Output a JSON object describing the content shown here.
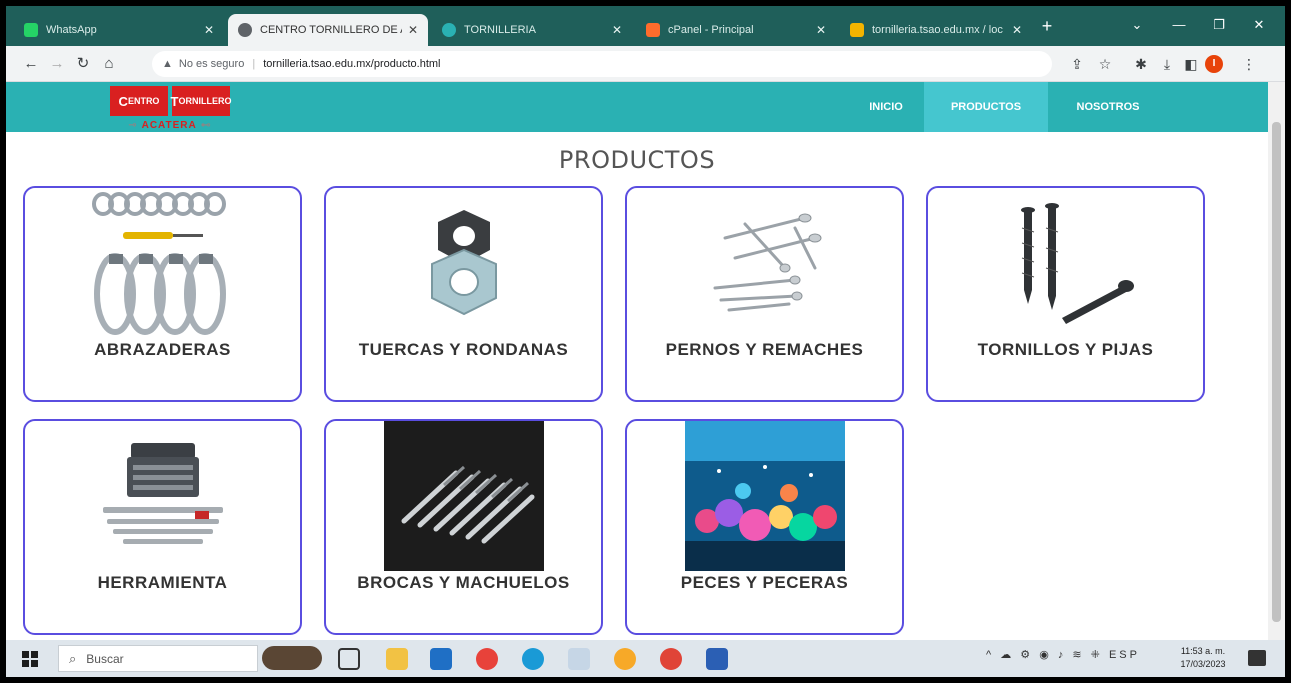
{
  "browser": {
    "tabs": [
      {
        "label": "WhatsApp",
        "color": "#25d366"
      },
      {
        "label": "CENTRO TORNILLERO DE AC",
        "color": "#5f6368"
      },
      {
        "label": "TORNILLERIA",
        "color": "#2ab1b3"
      },
      {
        "label": "cPanel - Principal",
        "color": "#ff6c2c"
      },
      {
        "label": "tornilleria.tsao.edu.mx / loc",
        "color": "#f4b400"
      }
    ],
    "new_tab": "+",
    "address": {
      "security": "No es seguro",
      "url": "tornilleria.tsao.edu.mx/producto.html"
    },
    "profile_initial": "I"
  },
  "site": {
    "logo": {
      "left": "ENTRO",
      "right": "ORNILLERO",
      "left_cap": "C",
      "right_cap": "T",
      "sub": "ACATERA"
    },
    "nav": [
      {
        "label": "INICIO"
      },
      {
        "label": "PRODUCTOS"
      },
      {
        "label": "NOSOTROS"
      }
    ],
    "active_nav": "PRODUCTOS",
    "title": "PRODUCTOS",
    "products": [
      {
        "name": "ABRAZADERAS",
        "icon": "hose-clamps-image"
      },
      {
        "name": "TUERCAS Y RONDANAS",
        "icon": "hex-nuts-image"
      },
      {
        "name": "PERNOS Y REMACHES",
        "icon": "rivets-image"
      },
      {
        "name": "TORNILLOS Y PIJAS",
        "icon": "screws-image"
      },
      {
        "name": "HERRAMIENTA",
        "icon": "toolbox-image"
      },
      {
        "name": "BROCAS Y MACHUELOS",
        "icon": "drill-bits-image"
      },
      {
        "name": "PECES Y PECERAS",
        "icon": "aquarium-image"
      }
    ]
  },
  "taskbar": {
    "search_placeholder": "Buscar",
    "tray": "^ ☁ ⚙ ◉ ♪ ≋ ⁜ ESP",
    "time": "11:53 a. m.",
    "date": "17/03/2023"
  }
}
